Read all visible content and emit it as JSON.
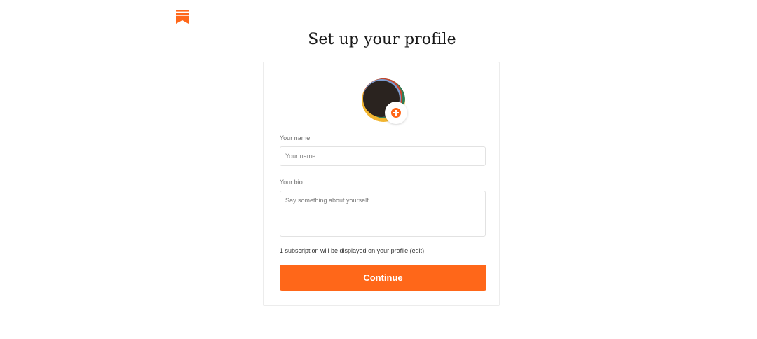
{
  "brand": {
    "logo_icon": "bookmark-logo-icon",
    "accent_color": "#ff6719"
  },
  "page": {
    "title": "Set up your profile"
  },
  "profile": {
    "avatar_icon": "profile-avatar-image",
    "add_photo_icon": "plus-circle-icon"
  },
  "form": {
    "name_label": "Your name",
    "name_placeholder": "Your name...",
    "name_value": "",
    "bio_label": "Your bio",
    "bio_placeholder": "Say something about yourself...",
    "bio_value": "",
    "subscription_note": "1 subscription will be displayed on your profile (",
    "subscription_edit": "edit",
    "subscription_note_end": ")",
    "continue_label": "Continue"
  }
}
